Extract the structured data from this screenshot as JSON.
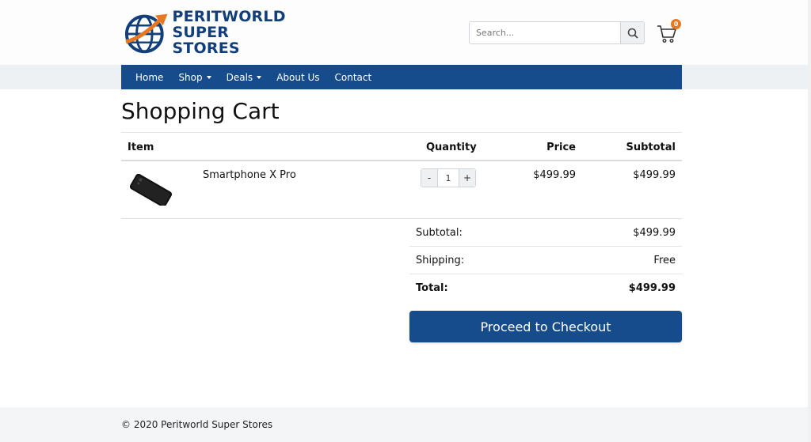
{
  "header": {
    "logo_line1": "PERITWORLD",
    "logo_line2": "SUPER STORES",
    "search_placeholder": "Search...",
    "search_icon": "magnifier-icon",
    "cart_icon": "shopping-cart-icon",
    "cart_count": "0"
  },
  "nav": {
    "items": [
      {
        "label": "Home"
      },
      {
        "label": "Shop"
      },
      {
        "label": "Deals"
      },
      {
        "label": "About Us"
      },
      {
        "label": "Contact"
      }
    ]
  },
  "page": {
    "title": "Shopping Cart"
  },
  "cart_table": {
    "headers": {
      "item": "Item",
      "quantity": "Quantity",
      "price": "Price",
      "subtotal": "Subtotal"
    },
    "rows": [
      {
        "name": "Smartphone X Pro",
        "quantity": "1",
        "minus": "-",
        "plus": "+",
        "price": "$499.99",
        "subtotal": "$499.99"
      }
    ]
  },
  "summary": {
    "subtotal_label": "Subtotal:",
    "subtotal_value": "$499.99",
    "shipping_label": "Shipping:",
    "shipping_value": "Free",
    "total_label": "Total:",
    "total_value": "$499.99"
  },
  "checkout_label": "Proceed to Checkout",
  "footer": {
    "text": "© 2020 Peritworld Super Stores"
  },
  "colors": {
    "brand_blue": "#164b8c",
    "accent_orange": "#e87722"
  }
}
